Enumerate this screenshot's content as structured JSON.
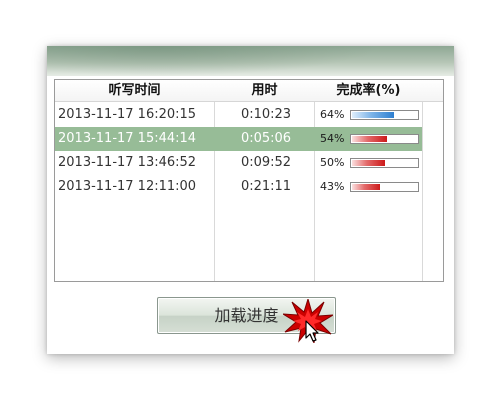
{
  "listview": {
    "columns": [
      "听写时间",
      "用时",
      "完成率(%)"
    ],
    "rows": [
      {
        "time": "2013-11-17 16:20:15",
        "duration": "0:10:23",
        "percent_label": "64%",
        "progress": 0.64,
        "bar_color": "#2e7fd0",
        "selected": false
      },
      {
        "time": "2013-11-17 15:44:14",
        "duration": "0:05:06",
        "percent_label": "54%",
        "progress": 0.54,
        "bar_color": "#cc1a1a",
        "selected": true
      },
      {
        "time": "2013-11-17 13:46:52",
        "duration": "0:09:52",
        "percent_label": "50%",
        "progress": 0.5,
        "bar_color": "#cc1a1a",
        "selected": false
      },
      {
        "time": "2013-11-17 12:11:00",
        "duration": "0:21:11",
        "percent_label": "43%",
        "progress": 0.43,
        "bar_color": "#cc1a1a",
        "selected": false
      }
    ]
  },
  "load_button": {
    "label": "加载进度"
  },
  "colors": {
    "selected_row": "#97bc97",
    "header_gradient": "#8ea794",
    "burst": "#cc0000"
  },
  "icons": {
    "burst": "red-starburst-icon",
    "cursor": "mouse-pointer-icon"
  }
}
